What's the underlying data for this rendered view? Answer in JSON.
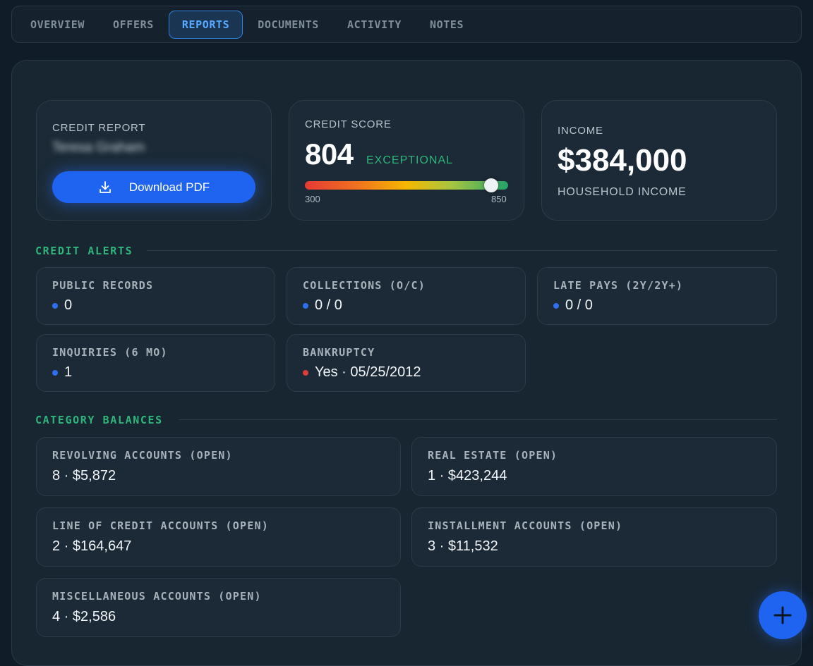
{
  "tabs": [
    {
      "label": "OVERVIEW",
      "active": false
    },
    {
      "label": "OFFERS",
      "active": false
    },
    {
      "label": "REPORTS",
      "active": true
    },
    {
      "label": "DOCUMENTS",
      "active": false
    },
    {
      "label": "ACTIVITY",
      "active": false
    },
    {
      "label": "NOTES",
      "active": false
    }
  ],
  "credit_report": {
    "label": "CREDIT REPORT",
    "name": "Teresa Graham",
    "download_label": "Download PDF",
    "icon": "download-icon"
  },
  "credit_score": {
    "label": "CREDIT SCORE",
    "score": "804",
    "rating": "EXCEPTIONAL",
    "min": "300",
    "max": "850",
    "value": 804,
    "range": [
      300,
      850
    ]
  },
  "income": {
    "label": "INCOME",
    "value": "$384,000",
    "sublabel": "HOUSEHOLD INCOME"
  },
  "alerts": {
    "title": "CREDIT ALERTS",
    "items": [
      {
        "label": "PUBLIC RECORDS",
        "value": "0",
        "status": "blue"
      },
      {
        "label": "COLLECTIONS (O/C)",
        "value": "0 / 0",
        "status": "blue"
      },
      {
        "label": "LATE PAYS (2Y/2Y+)",
        "value": "0 / 0",
        "status": "blue"
      },
      {
        "label": "INQUIRIES (6 MO)",
        "value": "1",
        "status": "blue"
      },
      {
        "label": "BANKRUPTCY",
        "value": "Yes · 05/25/2012",
        "status": "red"
      }
    ]
  },
  "balances": {
    "title": "CATEGORY BALANCES",
    "items": [
      {
        "label": "REVOLVING ACCOUNTS (OPEN)",
        "value": "8 · $5,872"
      },
      {
        "label": "REAL ESTATE (OPEN)",
        "value": "1 · $423,244"
      },
      {
        "label": "LINE OF CREDIT ACCOUNTS (OPEN)",
        "value": "2 · $164,647"
      },
      {
        "label": "INSTALLMENT ACCOUNTS (OPEN)",
        "value": "3 · $11,532"
      },
      {
        "label": "MISCELLANEOUS ACCOUNTS (OPEN)",
        "value": "4 · $2,586"
      }
    ]
  },
  "colors": {
    "accent": "#1e64f0",
    "positive": "#2fb57a",
    "dot_blue": "#2f6ff0",
    "dot_red": "#e03a3a"
  },
  "fab": {
    "icon": "plus-icon"
  }
}
